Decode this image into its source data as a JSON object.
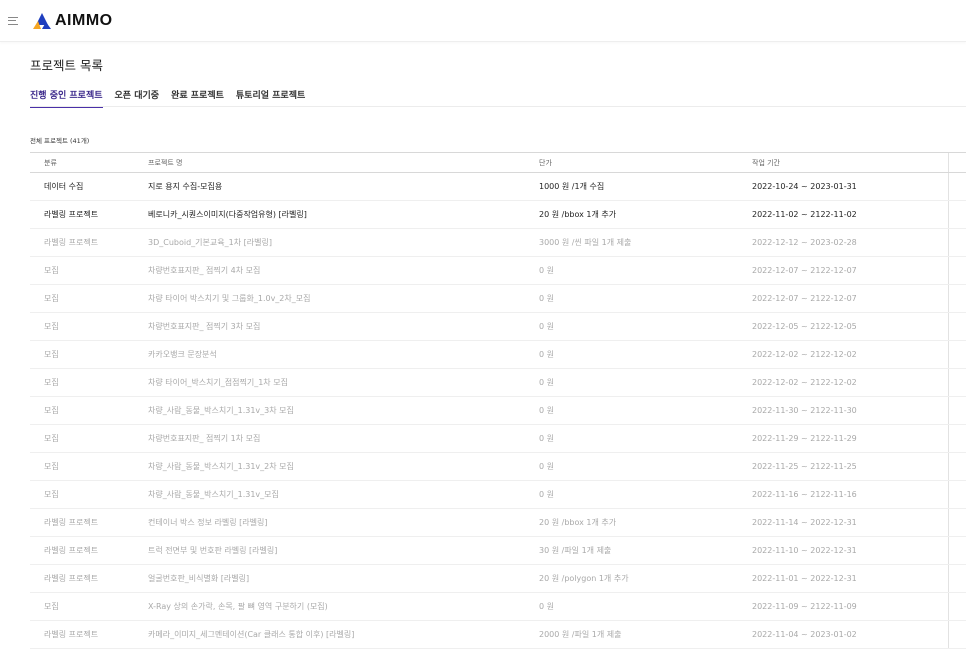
{
  "app": {
    "brand_name": "AIMMO"
  },
  "page": {
    "title": "프로젝트 목록"
  },
  "tabs": [
    {
      "label": "진행 중인 프로젝트",
      "active": true
    },
    {
      "label": "오픈 대기중",
      "active": false
    },
    {
      "label": "완료 프로젝트",
      "active": false
    },
    {
      "label": "튜토리얼 프로젝트",
      "active": false
    }
  ],
  "project_count": "전체 프로젝트 (41개)",
  "table": {
    "headers": [
      "분류",
      "프로젝트 명",
      "단가",
      "작업 기간"
    ],
    "rows": [
      {
        "category": "데이터 수집",
        "name": "지로 용지 수집-모집용",
        "price": "1000 원 /1개 수집",
        "period": "2022-10-24 ~ 2023-01-31",
        "style": "dark"
      },
      {
        "category": "라벨링 프로젝트",
        "name": "베로니카_시퀀스이미지(다중작업유형) [라벨링]",
        "price": "20 원 /bbox 1개 추가",
        "period": "2022-11-02 ~ 2122-11-02",
        "style": "dark"
      },
      {
        "category": "라벨링 프로젝트",
        "name": "3D_Cuboid_기본교육_1차 [라벨링]",
        "price": "3000 원 /씬 파일 1개 제출",
        "period": "2022-12-12 ~ 2023-02-28",
        "style": "light"
      },
      {
        "category": "모집",
        "name": "차량번호표지판_ 점찍기 4차 모집",
        "price": "0 원",
        "period": "2022-12-07 ~ 2122-12-07",
        "style": "light"
      },
      {
        "category": "모집",
        "name": "차량 타이어 박스치기 및 그룹화_1.0v_2차_모집",
        "price": "0 원",
        "period": "2022-12-07 ~ 2122-12-07",
        "style": "light"
      },
      {
        "category": "모집",
        "name": "차량번호표지판_ 점찍기 3차 모집",
        "price": "0 원",
        "period": "2022-12-05 ~ 2122-12-05",
        "style": "light"
      },
      {
        "category": "모집",
        "name": "카카오뱅크 문장분석",
        "price": "0 원",
        "period": "2022-12-02 ~ 2122-12-02",
        "style": "light"
      },
      {
        "category": "모집",
        "name": "차량 타이어_박스치기_점점찍기_1차 모집",
        "price": "0 원",
        "period": "2022-12-02 ~ 2122-12-02",
        "style": "light"
      },
      {
        "category": "모집",
        "name": "차량_사람_동물_박스치기_1.31v_3차 모집",
        "price": "0 원",
        "period": "2022-11-30 ~ 2122-11-30",
        "style": "light"
      },
      {
        "category": "모집",
        "name": "차량번호표지판_ 점찍기 1차 모집",
        "price": "0 원",
        "period": "2022-11-29 ~ 2122-11-29",
        "style": "light"
      },
      {
        "category": "모집",
        "name": "차량_사람_동물_박스치기_1.31v_2차 모집",
        "price": "0 원",
        "period": "2022-11-25 ~ 2122-11-25",
        "style": "light"
      },
      {
        "category": "모집",
        "name": "차량_사람_동물_박스치기_1.31v_모집",
        "price": "0 원",
        "period": "2022-11-16 ~ 2122-11-16",
        "style": "light"
      },
      {
        "category": "라벨링 프로젝트",
        "name": "컨테이너 박스 정보 라벨링 [라벨링]",
        "price": "20 원 /bbox 1개 추가",
        "period": "2022-11-14 ~ 2022-12-31",
        "style": "light"
      },
      {
        "category": "라벨링 프로젝트",
        "name": "트럭 전면부 및 번호판 라벨링 [라벨링]",
        "price": "30 원 /파일 1개 제출",
        "period": "2022-11-10 ~ 2022-12-31",
        "style": "light"
      },
      {
        "category": "라벨링 프로젝트",
        "name": "얼굴번호판_비식별화 [라벨링]",
        "price": "20 원 /polygon 1개 추가",
        "period": "2022-11-01 ~ 2022-12-31",
        "style": "light"
      },
      {
        "category": "모집",
        "name": "X-Ray 상의 손가락, 손목, 팔 뼈 영역 구분하기 (모집)",
        "price": "0 원",
        "period": "2022-11-09 ~ 2122-11-09",
        "style": "light"
      },
      {
        "category": "라벨링 프로젝트",
        "name": "카메라_이미지_세그멘테이션(Car 클래스 통합 이후) [라벨링]",
        "price": "2000 원 /파일 1개 제출",
        "period": "2022-11-04 ~ 2023-01-02",
        "style": "light"
      }
    ]
  },
  "colors": {
    "brand_blue": "#1f3fbf",
    "brand_orange": "#f5a623",
    "tab_active": "#4a30a8"
  },
  "icons": {
    "menu": "hamburger-menu-icon",
    "logo": "aimmo-logo-icon"
  }
}
